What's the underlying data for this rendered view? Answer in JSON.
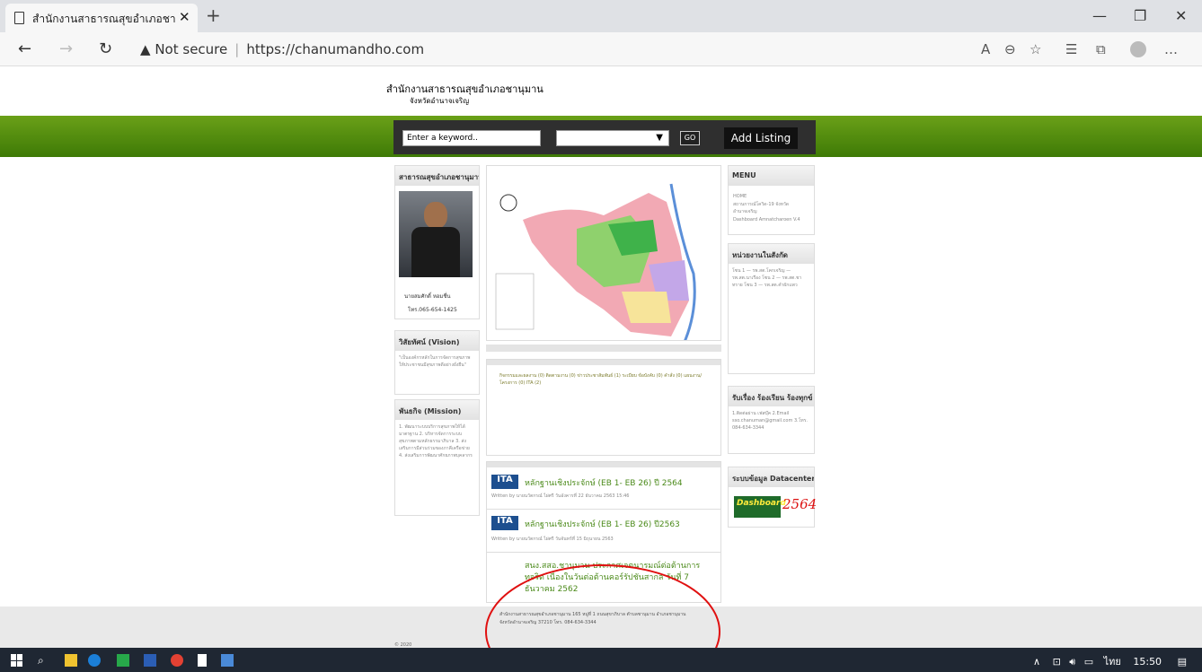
{
  "browser": {
    "tab_title": "สำนักงานสาธารณสุขอำเภอชานุมาน",
    "new_tab": "+",
    "close_tab": "✕",
    "security": "Not secure",
    "url": "https://chanumandho.com"
  },
  "site": {
    "title": "สำนักงานสาธารณสุขอำเภอชานุมาน",
    "subtitle": "จังหวัดอำนาจเจริญ"
  },
  "search": {
    "keyword_placeholder": "Enter a keyword..",
    "go_label": "GO",
    "add_listing_label": "Add Listing"
  },
  "left": {
    "header": "สาธารณสุขอำเภอชานุมาน",
    "person_name": "นายสมศักดิ์ หอมชื่น",
    "person_phone": "โทร.065-654-1425",
    "vision_title": "วิสัยทัศน์ (Vision)",
    "vision_text": "\"เป็นองค์กรหลักในการจัดการสุขภาพ ให้ประชาชนมีสุขภาพดีอย่างยั่งยืน\"",
    "mission_title": "พันธกิจ (Mission)",
    "mission_text": "1. พัฒนาระบบบริการสุขภาพให้ได้มาตรฐาน 2. บริหารจัดการระบบสุขภาพตามหลักธรรมาภิบาล 3. ส่งเสริมการมีส่วนร่วมของภาคีเครือข่าย 4. ส่งเสริมการพัฒนาศักยภาพบุคลากร"
  },
  "main": {
    "categories_text": "กิจกรรมและผลงาน (0) ติดตามงาน (0) ข่าวประชาสัมพันธ์ (1) ระเบียบ ข้อบังคับ (0) คำสั่ง (0) แผนงาน/โครงการ (0) ITA (2)",
    "posts": [
      {
        "title": "หลักฐานเชิงประจักษ์ (EB 1- EB 26) ปี 2564",
        "meta": "Written by นายนวัตกรณ์ ไผ่ศรี วันอังคารที่ 22 ธันวาคม 2563 15:46",
        "thumb": "ITA"
      },
      {
        "title": "หลักฐานเชิงประจักษ์ (EB 1- EB 26) ปี2563",
        "meta": "Written by นายนวัตกรณ์ ไผ่ศรี วันจันทร์ที่ 15 มิถุนายน 2563",
        "thumb": "ITA"
      },
      {
        "title": "สนง.สสอ.ชานุมาน ประกาศเจตนารมณ์ต่อต้านการทุจริต เนื่องในวันต่อต้านคอร์รัปชันสากล วันที่ 7 ธันวาคม 2562",
        "meta": "",
        "thumb": ""
      }
    ]
  },
  "right": {
    "menu_title": "MENU",
    "menu_items": [
      "HOME",
      "สถานการณ์โควิด-19 จังหวัดอำนาจเจริญ",
      "Dashboard Amnatcharoen V.4"
    ],
    "units_title": "หน่วยงานในสังกัด",
    "units_text": "โซน 1 — รพ.สต.โคกเจริญ — รพ.สต.นาเรือง โซน 2 — รพ.สต.ชาทราย โซน 3 — รพ.สต.คำผักแพว",
    "complaint_title": "รับเรื่อง ร้องเรียน ร้องทุกข์",
    "complaint_text": "1.ติดต่อผ่าน เฟสบุ๊ค 2.Email sso.chanuman@gmail.com 3.โทร. 084-634-3344",
    "datacenter_title": "ระบบข้อมูล Datacenter",
    "dashboard_label": "Dashboard",
    "dashboard_year": "2564"
  },
  "footer": {
    "address": "สำนักงานสาธารณสุขอำเภอชานุมาน 165 หมู่ที่ 1 ถนนสุขาภิบาล ตำบลชานุมาน อำเภอชานุมาน จังหวัดอำนาจเจริญ 37210 โทร. 084-634-3344",
    "copyright": "© 2020"
  },
  "taskbar": {
    "lang": "ไทย",
    "time": "15:50"
  }
}
